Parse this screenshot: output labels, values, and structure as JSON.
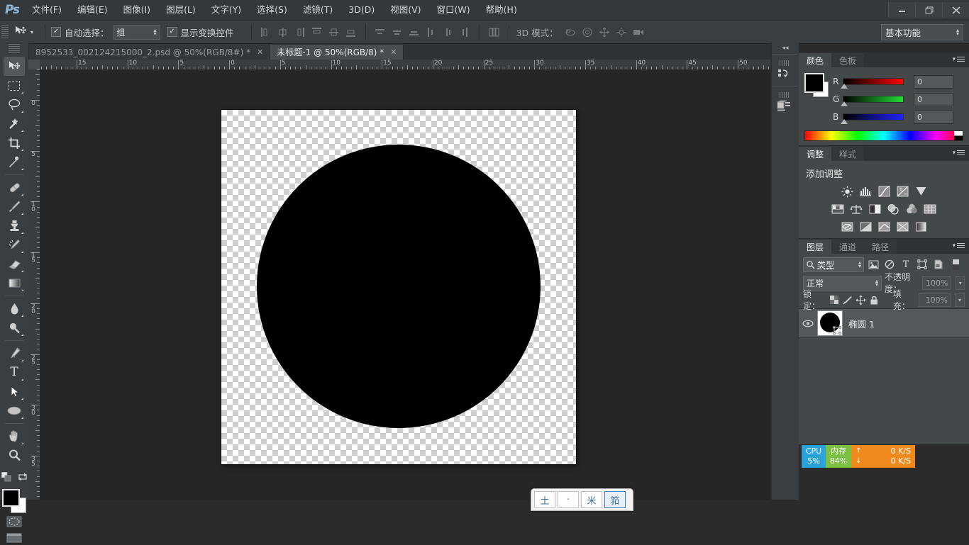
{
  "app": {
    "logo": "Ps",
    "window_controls": {
      "minimize": "—",
      "restore": "❐",
      "close": "✕"
    }
  },
  "menubar": [
    {
      "label": "文件(F)"
    },
    {
      "label": "编辑(E)"
    },
    {
      "label": "图像(I)"
    },
    {
      "label": "图层(L)"
    },
    {
      "label": "文字(Y)"
    },
    {
      "label": "选择(S)"
    },
    {
      "label": "滤镜(T)"
    },
    {
      "label": "3D(D)"
    },
    {
      "label": "视图(V)"
    },
    {
      "label": "窗口(W)"
    },
    {
      "label": "帮助(H)"
    }
  ],
  "options_bar": {
    "auto_select_label": "自动选择：",
    "auto_select_checked": "✓",
    "auto_select_value": "组",
    "show_transform_label": "显示变换控件",
    "show_transform_checked": "✓",
    "three_d_mode_label": "3D 模式：",
    "workspace": "基本功能"
  },
  "tabs": [
    {
      "title": "8952533_002124215000_2.psd @ 50%(RGB/8#) *",
      "close": "✕",
      "active": false
    },
    {
      "title": "未标题-1 @ 50%(RGB/8) *",
      "close": "✕",
      "active": true
    }
  ],
  "toolbar": {
    "tools": [
      {
        "name": "move-tool",
        "selected": true
      },
      {
        "name": "marquee-tool",
        "selected": false
      },
      {
        "name": "lasso-tool",
        "selected": false
      },
      {
        "name": "magic-wand-tool",
        "selected": false
      },
      {
        "name": "crop-tool",
        "selected": false
      },
      {
        "name": "eyedropper-tool",
        "selected": false
      },
      {
        "name": "healing-brush-tool",
        "selected": false
      },
      {
        "name": "brush-tool",
        "selected": false
      },
      {
        "name": "clone-stamp-tool",
        "selected": false
      },
      {
        "name": "history-brush-tool",
        "selected": false
      },
      {
        "name": "eraser-tool",
        "selected": false
      },
      {
        "name": "gradient-tool",
        "selected": false
      },
      {
        "name": "blur-tool",
        "selected": false
      },
      {
        "name": "dodge-tool",
        "selected": false
      },
      {
        "name": "pen-tool",
        "selected": false
      },
      {
        "name": "type-tool",
        "selected": false
      },
      {
        "name": "path-selection-tool",
        "selected": false
      },
      {
        "name": "ellipse-shape-tool",
        "selected": false
      },
      {
        "name": "hand-tool",
        "selected": false
      },
      {
        "name": "zoom-tool",
        "selected": false
      }
    ],
    "foreground_color": "#000000",
    "background_color": "#ffffff"
  },
  "rulers": {
    "horizontal_labels": [
      "15",
      "10",
      "5",
      "0",
      "5",
      "10",
      "15",
      "20",
      "25",
      "30",
      "35",
      "40",
      "45",
      "50"
    ],
    "vertical_labels": [
      "0",
      "5",
      "10",
      "15",
      "20",
      "25",
      "30",
      "35"
    ],
    "unit_zoom": "50%"
  },
  "canvas": {
    "document_name": "未标题-1",
    "zoom": "50%",
    "transparent": true,
    "shape": "ellipse",
    "shape_color": "#000000"
  },
  "color_panel": {
    "tabs": [
      {
        "label": "颜色",
        "active": true
      },
      {
        "label": "色板",
        "active": false
      }
    ],
    "channels": [
      {
        "label": "R",
        "value": "0",
        "color": "#ff0000"
      },
      {
        "label": "G",
        "value": "0",
        "color": "#00cc22"
      },
      {
        "label": "B",
        "value": "0",
        "color": "#2222ff"
      }
    ],
    "foreground": "#000000",
    "background": "#ffffff"
  },
  "adjustments_panel": {
    "tabs": [
      {
        "label": "调整",
        "active": true
      },
      {
        "label": "样式",
        "active": false
      }
    ],
    "title": "添加调整",
    "rows": [
      [
        {
          "name": "brightness-contrast-icon"
        },
        {
          "name": "levels-icon"
        },
        {
          "name": "curves-icon"
        },
        {
          "name": "exposure-icon"
        },
        {
          "name": "vibrance-icon"
        }
      ],
      [
        {
          "name": "hue-saturation-icon"
        },
        {
          "name": "color-balance-icon"
        },
        {
          "name": "black-white-icon"
        },
        {
          "name": "photo-filter-icon"
        },
        {
          "name": "channel-mixer-icon"
        },
        {
          "name": "color-lookup-icon"
        }
      ],
      [
        {
          "name": "invert-icon"
        },
        {
          "name": "posterize-icon"
        },
        {
          "name": "threshold-icon"
        },
        {
          "name": "gradient-map-icon"
        },
        {
          "name": "selective-color-icon"
        }
      ]
    ]
  },
  "layers_panel": {
    "tabs": [
      {
        "label": "图层",
        "active": true
      },
      {
        "label": "通道",
        "active": false
      },
      {
        "label": "路径",
        "active": false
      }
    ],
    "filter_value": "类型",
    "filter_icons": [
      "pixel-filter-icon",
      "adjustment-filter-icon",
      "type-filter-icon",
      "shape-filter-icon",
      "smart-object-filter-icon"
    ],
    "blend_mode": "正常",
    "opacity_label": "不透明度：",
    "opacity_value": "100%",
    "lock_label": "锁定：",
    "lock_icons": [
      "lock-transparency-icon",
      "lock-image-icon",
      "lock-position-icon",
      "lock-all-icon"
    ],
    "fill_label": "填充：",
    "fill_value": "100%",
    "layers": [
      {
        "name": "椭圆 1",
        "visible": true,
        "type": "shape",
        "thumb_color": "#000000"
      }
    ]
  },
  "status_widget": {
    "cpu_label": "CPU",
    "cpu_value": "5%",
    "mem_label": "内存",
    "mem_value": "84%",
    "upload": "0 K/S",
    "download": "0 K/S",
    "up_arrow": "↑",
    "down_arrow": "↓",
    "colors": {
      "cpu": "#2aa3d8",
      "mem": "#7bc043",
      "net": "#f08a1c"
    }
  },
  "ime_bar": {
    "keys": [
      "土",
      "·",
      "米",
      "筘"
    ]
  }
}
